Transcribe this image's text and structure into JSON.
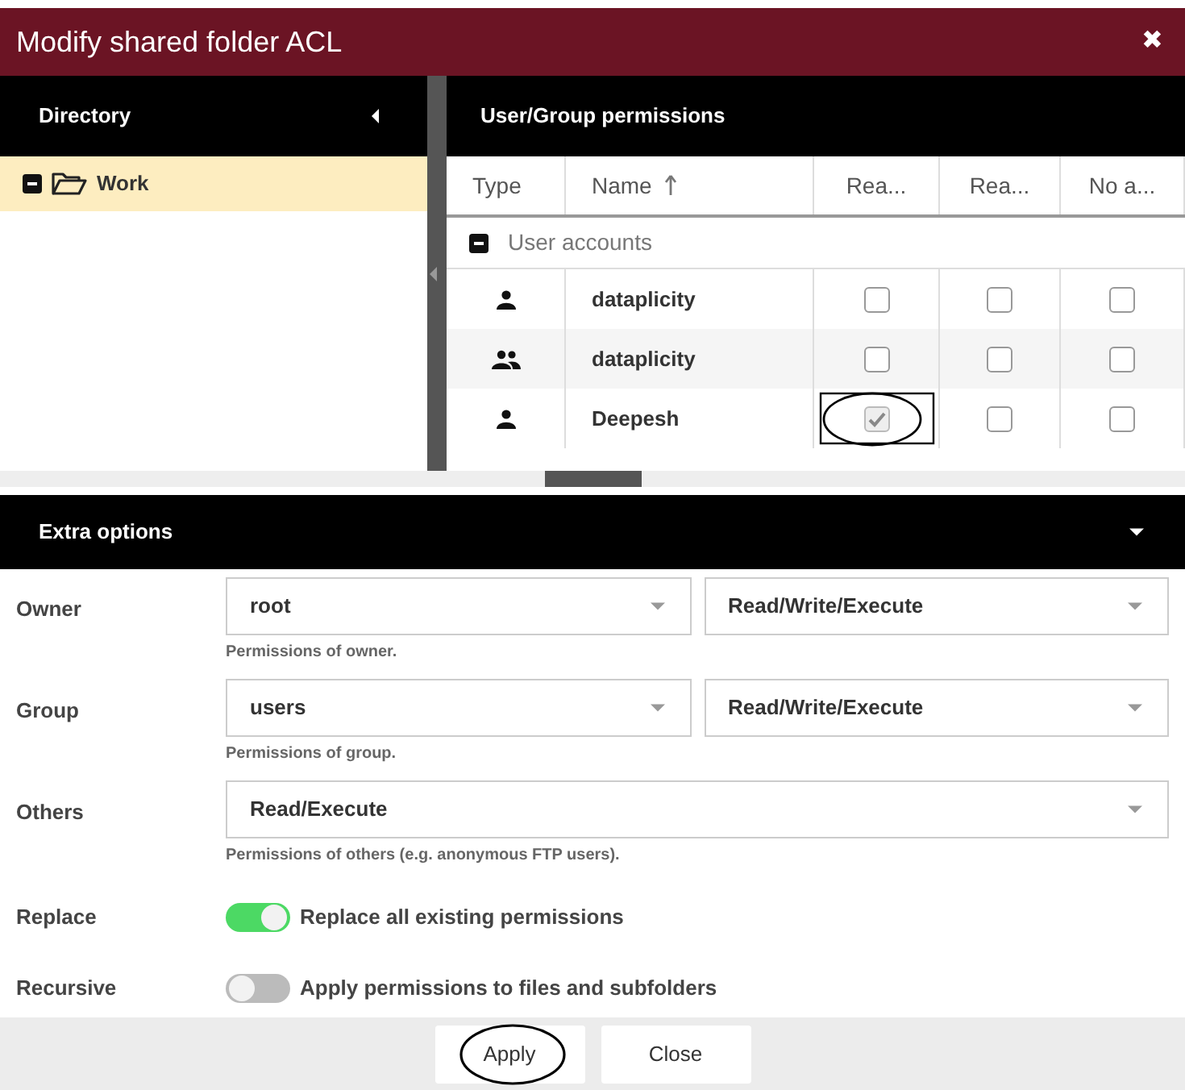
{
  "window": {
    "title": "Modify shared folder ACL",
    "close": "✖"
  },
  "directory": {
    "title": "Directory",
    "items": [
      {
        "label": "Work",
        "selected": true,
        "expanded": true
      }
    ]
  },
  "permissions": {
    "title": "User/Group permissions",
    "columns": [
      {
        "label": "Type"
      },
      {
        "label": "Name",
        "sorted": true
      },
      {
        "label": "Rea..."
      },
      {
        "label": "Rea..."
      },
      {
        "label": "No a..."
      }
    ],
    "group": {
      "label": "User accounts",
      "expanded": true
    },
    "rows": [
      {
        "kind": "user",
        "name": "dataplicity",
        "checks": [
          false,
          false,
          false
        ],
        "circled": false
      },
      {
        "kind": "group",
        "name": "dataplicity",
        "checks": [
          false,
          false,
          false
        ],
        "circled": false
      },
      {
        "kind": "user",
        "name": "Deepesh",
        "checks": [
          true,
          false,
          false
        ],
        "circled": true
      }
    ]
  },
  "extra": {
    "title": "Extra options",
    "expanded": true,
    "fields": [
      {
        "label": "Owner",
        "selects": [
          "root",
          "Read/Write/Execute"
        ],
        "hint": "Permissions of owner."
      },
      {
        "label": "Group",
        "selects": [
          "users",
          "Read/Write/Execute"
        ],
        "hint": "Permissions of group."
      },
      {
        "label": "Others",
        "selects": [
          "Read/Execute"
        ],
        "hint": "Permissions of others (e.g. anonymous FTP users)."
      }
    ],
    "switches": [
      {
        "label": "Replace",
        "text": "Replace all existing permissions",
        "on": true
      },
      {
        "label": "Recursive",
        "text": "Apply permissions to files and subfolders",
        "on": false
      }
    ]
  },
  "buttons": [
    {
      "label": "Apply",
      "circled": true
    },
    {
      "label": "Close",
      "circled": false
    }
  ]
}
